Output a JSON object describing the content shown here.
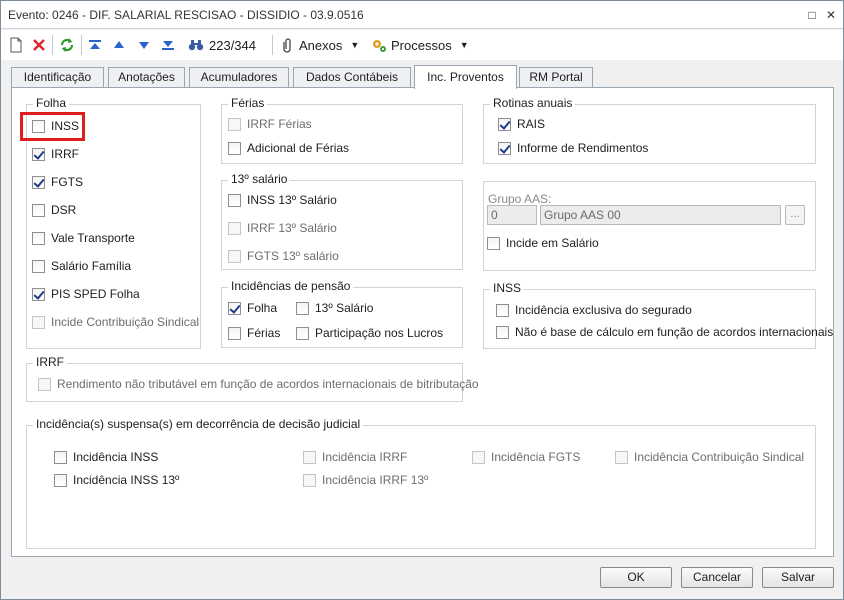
{
  "window": {
    "title": "Evento: 0246 - DIF. SALARIAL RESCISAO - DISSIDIO - 03.9.0516",
    "maximize": "□",
    "close": "✕"
  },
  "toolbar": {
    "record_counter": "223/344",
    "anexos_label": "Anexos",
    "processos_label": "Processos"
  },
  "tabs": [
    {
      "label": "Identificação"
    },
    {
      "label": "Anotações"
    },
    {
      "label": "Acumuladores"
    },
    {
      "label": "Dados Contábeis"
    },
    {
      "label": "Inc. Proventos"
    },
    {
      "label": "RM Portal"
    }
  ],
  "folha": {
    "title": "Folha",
    "items": [
      {
        "label": "INSS",
        "checked": false
      },
      {
        "label": "IRRF",
        "checked": true
      },
      {
        "label": "FGTS",
        "checked": true
      },
      {
        "label": "DSR",
        "checked": false
      },
      {
        "label": "Vale Transporte",
        "checked": false
      },
      {
        "label": "Salário Família",
        "checked": false
      },
      {
        "label": "PIS SPED Folha",
        "checked": true
      },
      {
        "label": "Incide Contribuição Sindical",
        "checked": false,
        "disabled": true
      }
    ]
  },
  "ferias": {
    "title": "Férias",
    "items": [
      {
        "label": "IRRF Férias",
        "checked": false,
        "disabled": true
      },
      {
        "label": "Adicional de Férias",
        "checked": false
      }
    ]
  },
  "decimo": {
    "title": "13º salário",
    "items": [
      {
        "label": "INSS 13º Salário",
        "checked": false
      },
      {
        "label": "IRRF 13º Salário",
        "checked": false,
        "disabled": true
      },
      {
        "label": "FGTS 13º salário",
        "checked": false,
        "disabled": true
      }
    ]
  },
  "pensao": {
    "title": "Incidências de pensão",
    "items": [
      {
        "label": "Folha",
        "checked": true
      },
      {
        "label": "13º Salário",
        "checked": false
      },
      {
        "label": "Férias",
        "checked": false
      },
      {
        "label": "Participação nos Lucros",
        "checked": false
      }
    ]
  },
  "rotinas": {
    "title": "Rotinas anuais",
    "items": [
      {
        "label": "RAIS",
        "checked": true
      },
      {
        "label": "Informe de Rendimentos",
        "checked": true
      }
    ]
  },
  "aas": {
    "label": "Grupo AAS:",
    "code": "0",
    "name": "Grupo AAS 00",
    "lookup": "...",
    "incide_label": "Incide em Salário",
    "incide_checked": false
  },
  "inss": {
    "title": "INSS",
    "items": [
      {
        "label": "Incidência exclusiva do segurado",
        "checked": false
      },
      {
        "label": "Não é base de cálculo em função de acordos internacionais",
        "checked": false
      }
    ]
  },
  "irrf": {
    "title": "IRRF",
    "items": [
      {
        "label": "Rendimento não tributável em função de acordos internacionais de bitributação",
        "checked": false,
        "disabled": true
      }
    ]
  },
  "suspensa": {
    "title": "Incidência(s) suspensa(s) em decorrência de decisão judicial",
    "items": [
      {
        "label": "Incidência INSS",
        "checked": false
      },
      {
        "label": "Incidência IRRF",
        "checked": false,
        "disabled": true
      },
      {
        "label": "Incidência FGTS",
        "checked": false,
        "disabled": true
      },
      {
        "label": "Incidência Contribuição Sindical",
        "checked": false,
        "disabled": true
      },
      {
        "label": "Incidência INSS 13º",
        "checked": false
      },
      {
        "label": "Incidência IRRF 13º",
        "checked": false,
        "disabled": true
      }
    ]
  },
  "footer": {
    "ok_label": "OK",
    "cancel_label": "Cancelar",
    "save_label": "Salvar"
  },
  "colors": {
    "highlight": "#e01e1e",
    "check": "#1f3a8a"
  }
}
